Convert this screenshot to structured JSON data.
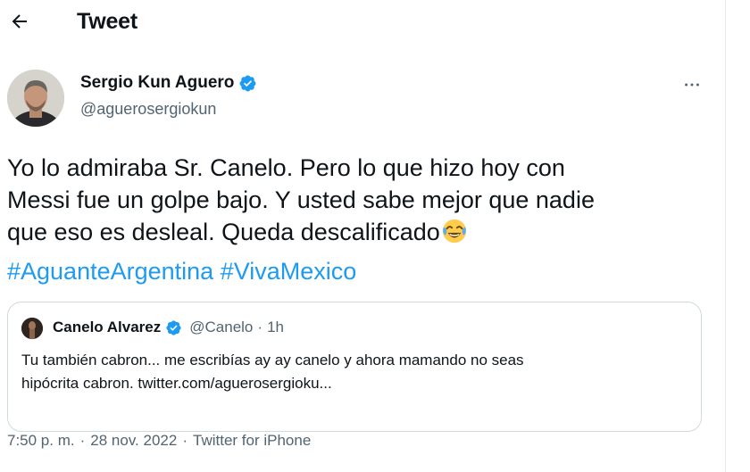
{
  "header": {
    "title": "Tweet"
  },
  "author": {
    "name": "Sergio Kun Aguero",
    "handle": "@aguerosergiokun"
  },
  "tweet": {
    "lines": [
      "Yo lo admiraba Sr. Canelo. Pero lo que hizo hoy con",
      "Messi fue un golpe bajo. Y usted sabe mejor que nadie",
      "que eso es desleal. Queda descalificado"
    ],
    "hashtags": [
      "#AguanteArgentina",
      "#VivaMexico"
    ]
  },
  "quoted": {
    "name": "Canelo Alvarez",
    "handle": "@Canelo",
    "separator": "·",
    "time": "1h",
    "text_lines": [
      "Tu también cabron... me escribías ay ay canelo y ahora mamando no seas",
      "hipócrita cabron. twitter.com/aguerosergioku..."
    ]
  },
  "meta": {
    "time": "7:50 p. m.",
    "date": "28 nov. 2022",
    "source": "Twitter for iPhone",
    "separator": "·"
  },
  "icons": {
    "back": "back-arrow-icon",
    "verified": "verified-badge-icon",
    "more": "more-options-icon",
    "emoji": "tears-of-joy-emoji"
  },
  "colors": {
    "link": "#1d9bf0",
    "secondary_text": "#536471",
    "primary_text": "#0f1419",
    "border": "#cfd9de"
  }
}
